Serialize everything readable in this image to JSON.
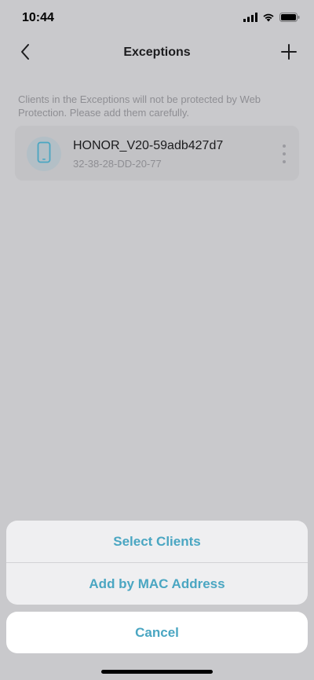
{
  "status_bar": {
    "time": "10:44",
    "signal_icon": "cellular-signal-icon",
    "wifi_icon": "wifi-icon",
    "battery_icon": "battery-icon"
  },
  "nav": {
    "title": "Exceptions",
    "back_icon": "chevron-left-icon",
    "add_icon": "plus-icon"
  },
  "notice": "Clients in the Exceptions will not be protected by Web Protection. Please add them carefully.",
  "clients": [
    {
      "name": "HONOR_V20-59adb427d7",
      "mac": "32-38-28-DD-20-77",
      "icon": "smartphone-icon"
    }
  ],
  "action_sheet": {
    "select_clients": "Select Clients",
    "add_by_mac": "Add by MAC Address",
    "cancel": "Cancel"
  },
  "colors": {
    "accent": "#4aa6c2",
    "dimmed_background": "#c9c9cc"
  }
}
